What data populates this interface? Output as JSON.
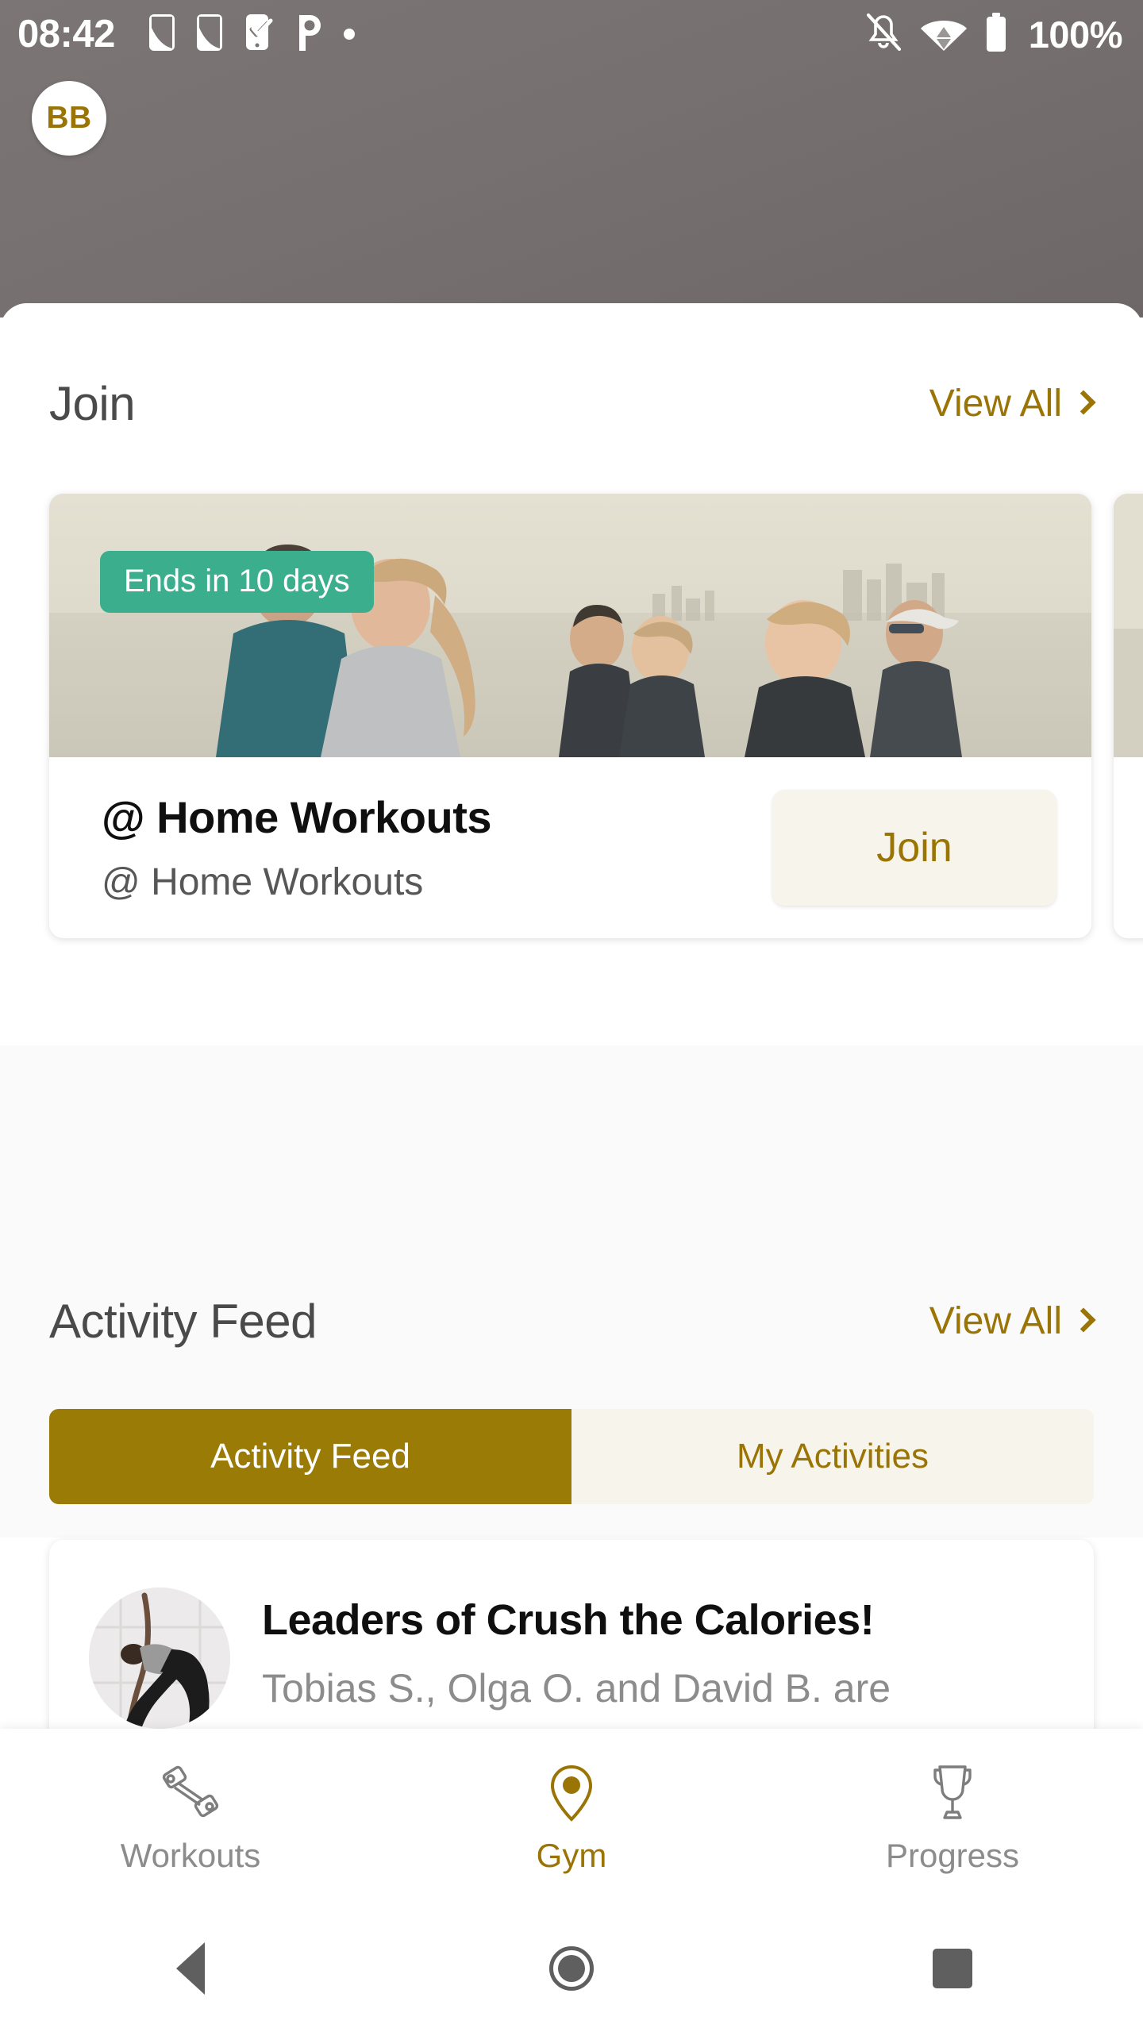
{
  "status_bar": {
    "clock": "08:42",
    "battery_text": "100%",
    "left_icons": [
      "app-phone-icon",
      "app-phone-icon",
      "phone-check-icon",
      "p-logo-icon",
      "dot-icon"
    ],
    "right_icons": [
      "notifications-off-icon",
      "wifi-icon",
      "battery-full-icon"
    ]
  },
  "header": {
    "avatar_initials": "BB"
  },
  "join_section": {
    "title": "Join",
    "view_all": "View All",
    "cards": [
      {
        "badge": "Ends in 10 days",
        "title": "@ Home Workouts",
        "subtitle": "@ Home Workouts",
        "action": "Join"
      },
      {
        "badge": "",
        "title": "",
        "subtitle": "",
        "action": ""
      }
    ]
  },
  "activity_section": {
    "title": "Activity Feed",
    "view_all": "View All",
    "tabs": [
      {
        "label": "Activity Feed",
        "active": true
      },
      {
        "label": "My Activities",
        "active": false
      }
    ],
    "items": [
      {
        "title": "Leaders of Crush the Calories!",
        "subtitle": "Tobias S., Olga O. and David B. are"
      }
    ]
  },
  "bottom_nav": {
    "items": [
      {
        "label": "Workouts",
        "icon": "dumbbell-icon",
        "active": false
      },
      {
        "label": "Gym",
        "icon": "location-pin-icon",
        "active": true
      },
      {
        "label": "Progress",
        "icon": "trophy-icon",
        "active": false
      }
    ]
  },
  "android_nav": {
    "back": "back-button",
    "home": "home-button",
    "recents": "recents-button"
  },
  "colors": {
    "accent_gold": "#9a7405",
    "tab_active_gold": "#9a7b05",
    "badge_teal": "#3aae8d",
    "cream": "#f7f4ec",
    "header_gray": "#767070"
  }
}
